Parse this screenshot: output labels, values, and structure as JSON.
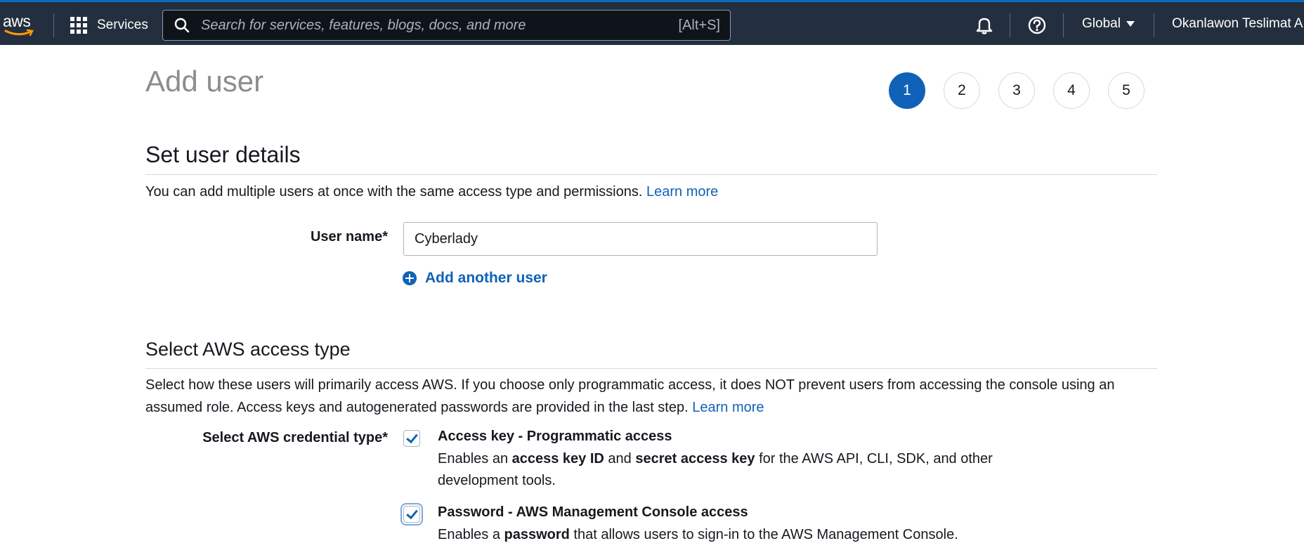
{
  "nav": {
    "logo_text": "aws",
    "services_label": "Services",
    "search_placeholder": "Search for services, features, blogs, docs, and more",
    "search_shortcut": "[Alt+S]",
    "region": "Global",
    "user": "Okanlawon Teslimat A",
    "icons": [
      "grid-icon",
      "search-icon",
      "bell-icon",
      "help-icon",
      "caret-down-icon"
    ]
  },
  "page": {
    "title": "Add user",
    "steps": [
      "1",
      "2",
      "3",
      "4",
      "5"
    ],
    "active_step": "1"
  },
  "user_details": {
    "title": "Set user details",
    "description": "You can add multiple users at once with the same access type and permissions.",
    "learn_more": "Learn more",
    "user_name_label": "User name*",
    "user_name_value": "Cyberlady",
    "add_another_label": "Add another user"
  },
  "access_type": {
    "title": "Select AWS access type",
    "description": "Select how these users will primarily access AWS. If you choose only programmatic access, it does NOT prevent users from accessing the console using an assumed role. Access keys and autogenerated passwords are provided in the last step.",
    "learn_more": "Learn more",
    "credential_label": "Select AWS credential type*",
    "options": [
      {
        "title": "Access key - Programmatic access",
        "checked": true,
        "desc_1": "Enables an ",
        "desc_b1": "access key ID",
        "desc_2": " and ",
        "desc_b2": "secret access key",
        "desc_3": " for the AWS API, CLI, SDK, and other development tools."
      },
      {
        "title": "Password - AWS Management Console access",
        "checked": true,
        "desc_1": "Enables a ",
        "desc_b1": "password",
        "desc_2": " that allows users to sign-in to the AWS Management Console."
      }
    ]
  },
  "colors": {
    "nav_bg": "#232f3e",
    "accent": "#0f62b7",
    "title_gray": "#8d8d8d"
  }
}
